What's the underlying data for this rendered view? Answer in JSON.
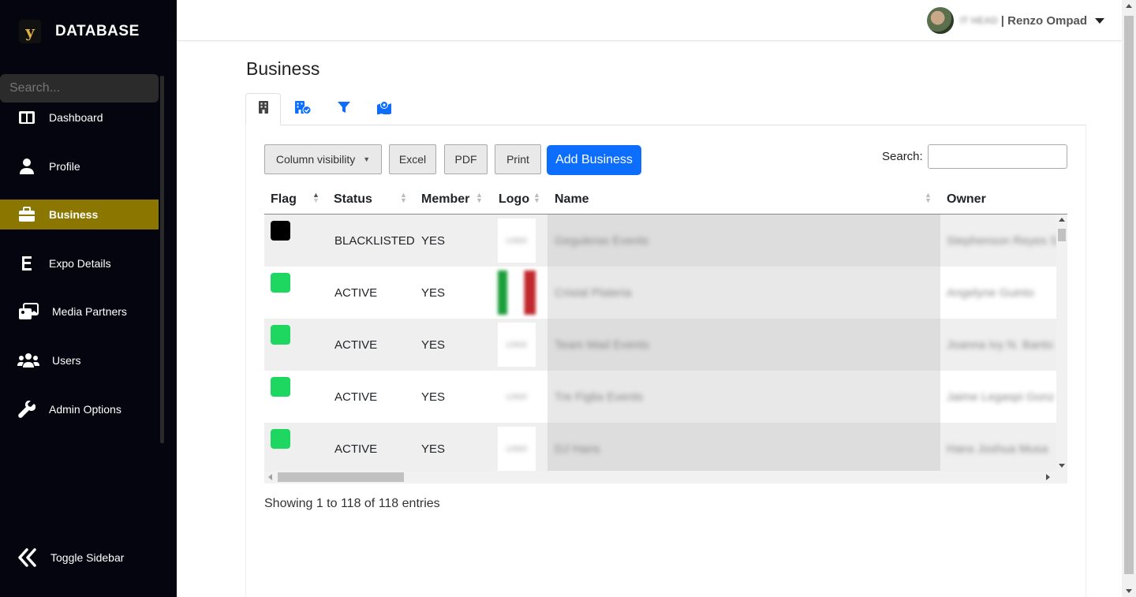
{
  "sidebar": {
    "brand_letter": "y",
    "brand_title": "DATABASE",
    "search_placeholder": "Search...",
    "items": [
      {
        "label": "Dashboard",
        "icon": "columns-icon",
        "active": false
      },
      {
        "label": "Profile",
        "icon": "user-icon",
        "active": false
      },
      {
        "label": "Business",
        "icon": "briefcase-icon",
        "active": true
      },
      {
        "label": "Expo Details",
        "icon": "letter-e-icon",
        "active": false
      },
      {
        "label": "Media Partners",
        "icon": "images-icon",
        "active": false
      },
      {
        "label": "Users",
        "icon": "users-icon",
        "active": false
      },
      {
        "label": "Admin Options",
        "icon": "wrench-icon",
        "active": false
      }
    ],
    "toggle_label": "Toggle Sidebar"
  },
  "topbar": {
    "role": "IT HEAD",
    "user_name": "| Renzo Ompad"
  },
  "page": {
    "title": "Business",
    "tabs": [
      "building-icon",
      "building-check-icon",
      "filter-icon",
      "map-location-icon"
    ]
  },
  "toolbar": {
    "column_visibility": "Column visibility",
    "excel": "Excel",
    "pdf": "PDF",
    "print": "Print",
    "add_business": "Add Business",
    "search_label": "Search:"
  },
  "table": {
    "headers": [
      "Flag",
      "Status",
      "Member",
      "Logo",
      "Name",
      "Owner"
    ],
    "rows": [
      {
        "flag_color": "#000000",
        "status": "BLACKLISTED",
        "member": "YES",
        "name": "Geguleras Events",
        "owner": "Stephenson Reyes S"
      },
      {
        "flag_color": "#1ed760",
        "status": "ACTIVE",
        "member": "YES",
        "name": "Cristal Plateria",
        "owner": "Angelyne Guinto"
      },
      {
        "flag_color": "#1ed760",
        "status": "ACTIVE",
        "member": "YES",
        "name": "Team Mad Events",
        "owner": "Joanna Ivy N. Banto"
      },
      {
        "flag_color": "#1ed760",
        "status": "ACTIVE",
        "member": "YES",
        "name": "Tre Figlia Events",
        "owner": "Jaime Legaspi Gonz"
      },
      {
        "flag_color": "#1ed760",
        "status": "ACTIVE",
        "member": "YES",
        "name": "DJ Hans",
        "owner": "Hans Joshua Musa"
      }
    ],
    "info": "Showing 1 to 118 of 118 entries"
  },
  "colors": {
    "accent": "#8b7600",
    "primary": "#0d6efd",
    "sidebar_bg": "#050510"
  }
}
